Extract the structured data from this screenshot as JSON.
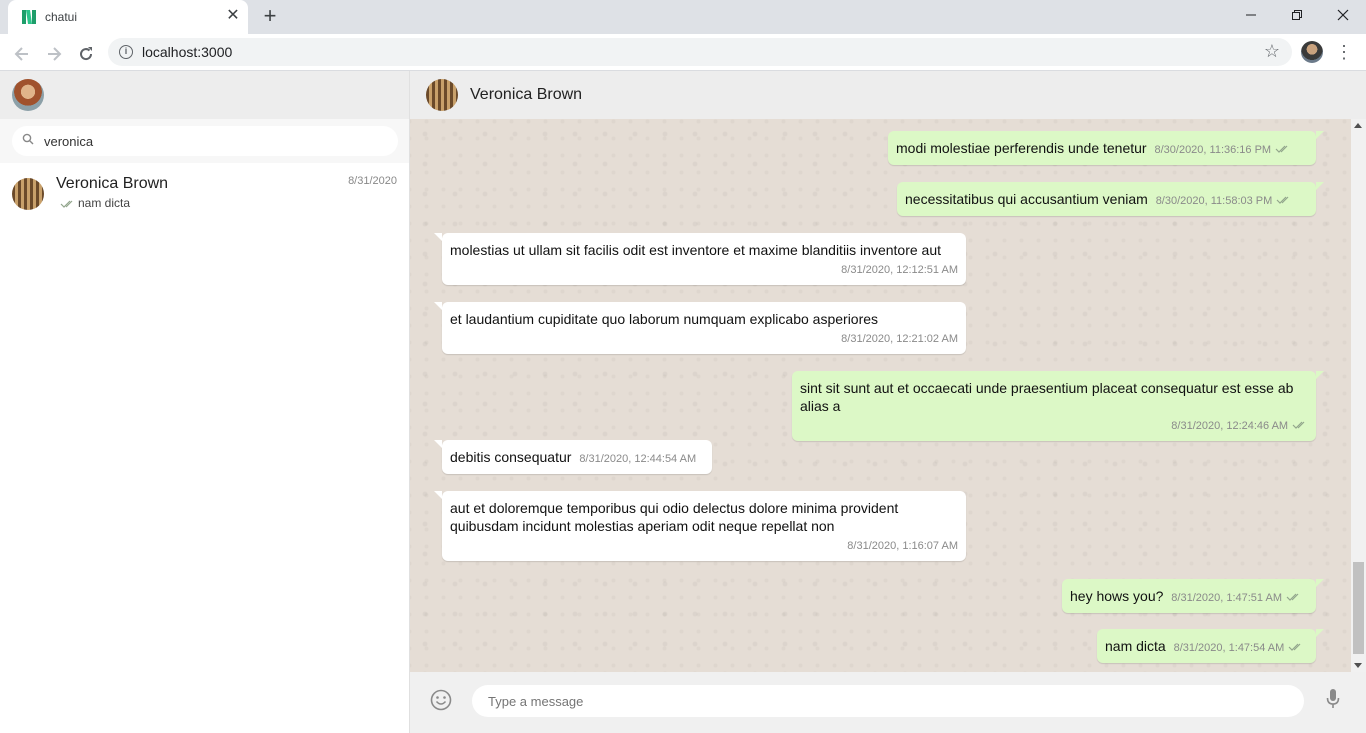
{
  "browser": {
    "tab_title": "chatui",
    "tab_close": "✕",
    "new_tab": "+",
    "url": "localhost:3000"
  },
  "sidebar": {
    "search": {
      "value": "veronica"
    },
    "contacts": [
      {
        "name": "Veronica Brown",
        "date": "8/31/2020",
        "last_message": "nam dicta"
      }
    ]
  },
  "chat": {
    "contact_name": "Veronica Brown",
    "messages": [
      {
        "direction": "out",
        "text": "modi molestiae perferendis unde tenetur",
        "time": "8/30/2020, 11:36:16 PM"
      },
      {
        "direction": "out",
        "text": "necessitatibus qui accusantium veniam",
        "time": "8/30/2020, 11:58:03 PM"
      },
      {
        "direction": "in",
        "text": "molestias ut ullam sit facilis odit est inventore et maxime blanditiis inventore aut",
        "time": "8/31/2020, 12:12:51 AM"
      },
      {
        "direction": "in",
        "text": "et laudantium cupiditate quo laborum numquam explicabo asperiores",
        "time": "8/31/2020, 12:21:02 AM"
      },
      {
        "direction": "out",
        "text": "sint sit sunt aut et occaecati unde praesentium placeat consequatur est esse ab alias a",
        "time": "8/31/2020, 12:24:46 AM"
      },
      {
        "direction": "in",
        "text": "debitis consequatur",
        "time": "8/31/2020, 12:44:54 AM"
      },
      {
        "direction": "in",
        "text": "aut et doloremque temporibus qui odio delectus dolore minima provident quibusdam incidunt molestias aperiam odit neque repellat non",
        "time": "8/31/2020, 1:16:07 AM"
      },
      {
        "direction": "out",
        "text": "hey hows you?",
        "time": "8/31/2020, 1:47:51 AM"
      },
      {
        "direction": "out",
        "text": "nam dicta",
        "time": "8/31/2020, 1:47:54 AM"
      }
    ],
    "composer": {
      "placeholder": "Type a message"
    }
  }
}
